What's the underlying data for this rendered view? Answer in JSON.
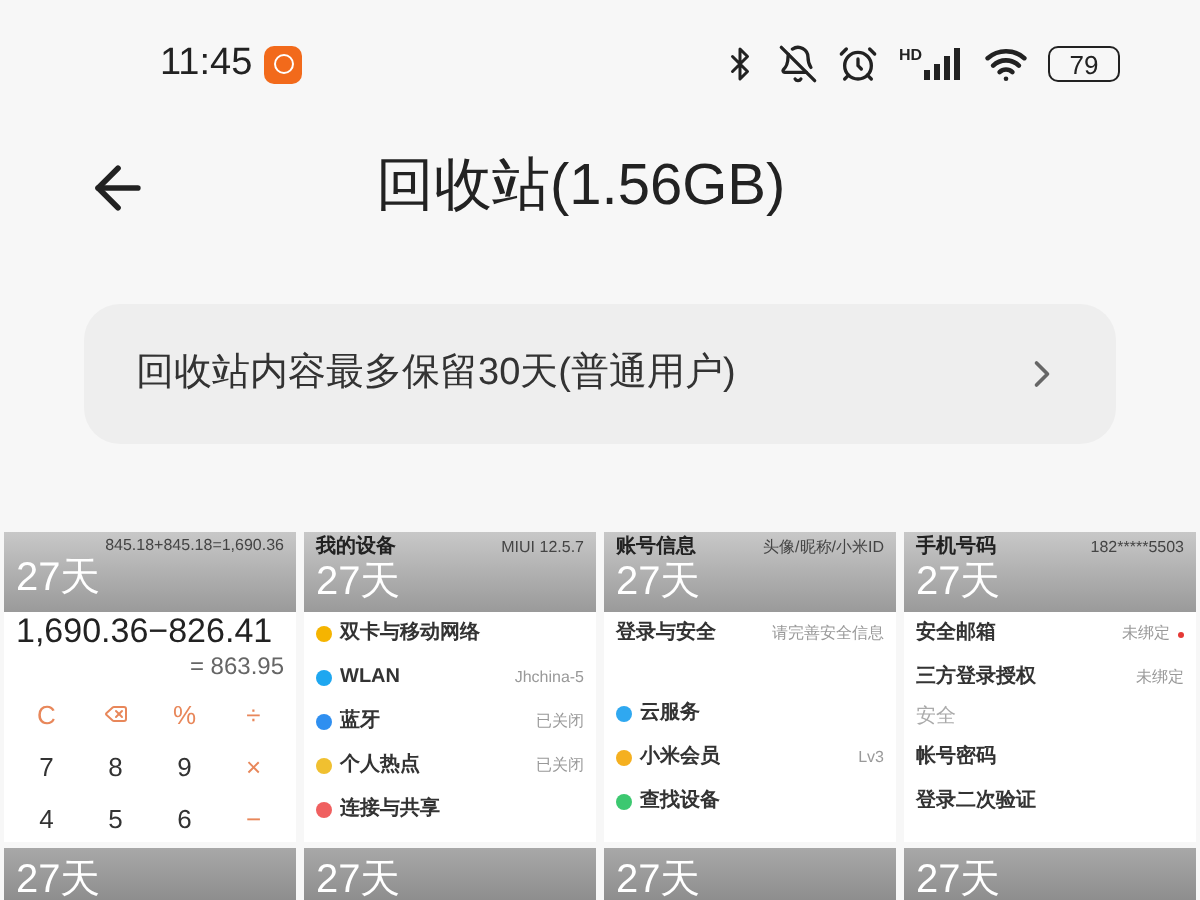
{
  "status_bar": {
    "time": "11:45",
    "network_label": "HD",
    "battery": "79"
  },
  "header": {
    "title": "回收站(1.56GB)"
  },
  "notice": {
    "text": "回收站内容最多保留30天(普通用户)"
  },
  "items": [
    {
      "kind": "calculator",
      "days": "27天",
      "history": "845.18+845.18=1,690.36",
      "expression": "1,690.36−826.41",
      "result": "= 863.95",
      "keys": [
        {
          "kind": "op",
          "label": "C"
        },
        {
          "kind": "backspace"
        },
        {
          "kind": "op",
          "label": "%"
        },
        {
          "kind": "op",
          "label": "÷"
        },
        {
          "kind": "num",
          "label": "7"
        },
        {
          "kind": "num",
          "label": "8"
        },
        {
          "kind": "num",
          "label": "9"
        },
        {
          "kind": "op",
          "label": "×"
        },
        {
          "kind": "num",
          "label": "4"
        },
        {
          "kind": "num",
          "label": "5"
        },
        {
          "kind": "num",
          "label": "6"
        },
        {
          "kind": "op",
          "label": "−"
        }
      ]
    },
    {
      "kind": "settings",
      "days": "27天",
      "top_label": "我的设备",
      "top_value": "MIUI 12.5.7",
      "rows": [
        {
          "kind": "row",
          "label": "双卡与移动网络",
          "color": "#f5b400"
        },
        {
          "kind": "row",
          "label": "WLAN",
          "value": "Jhchina-5",
          "color": "#1ea7f0"
        },
        {
          "kind": "row",
          "label": "蓝牙",
          "value": "已关闭",
          "color": "#2f8ff0"
        },
        {
          "kind": "row",
          "label": "个人热点",
          "value": "已关闭",
          "color": "#f0c030"
        },
        {
          "kind": "row",
          "label": "连接与共享",
          "color": "#f06060"
        }
      ]
    },
    {
      "kind": "settings",
      "days": "27天",
      "top_label": "账号信息",
      "top_value": "头像/昵称/小米ID",
      "rows": [
        {
          "kind": "row",
          "label": "登录与安全",
          "value": "请完善安全信息"
        },
        {
          "kind": "gap"
        },
        {
          "kind": "row",
          "label": "云服务",
          "color": "#2fa8f0"
        },
        {
          "kind": "row",
          "label": "小米会员",
          "value": "Lv3",
          "color": "#f5b020"
        },
        {
          "kind": "row",
          "label": "查找设备",
          "color": "#3cc870"
        }
      ]
    },
    {
      "kind": "settings",
      "days": "27天",
      "top_label": "手机号码",
      "top_value": "182*****5503",
      "rows": [
        {
          "kind": "row",
          "label": "安全邮箱",
          "value": "未绑定",
          "alert": true
        },
        {
          "kind": "row",
          "label": "三方登录授权",
          "value": "未绑定",
          "alert": false
        },
        {
          "kind": "section",
          "label": "安全"
        },
        {
          "kind": "row",
          "label": "帐号密码"
        },
        {
          "kind": "row",
          "label": "登录二次验证"
        }
      ]
    },
    {
      "kind": "partial",
      "days": "27天"
    },
    {
      "kind": "partial",
      "days": "27天"
    },
    {
      "kind": "partial",
      "days": "27天"
    },
    {
      "kind": "partial",
      "days": "27天"
    }
  ]
}
